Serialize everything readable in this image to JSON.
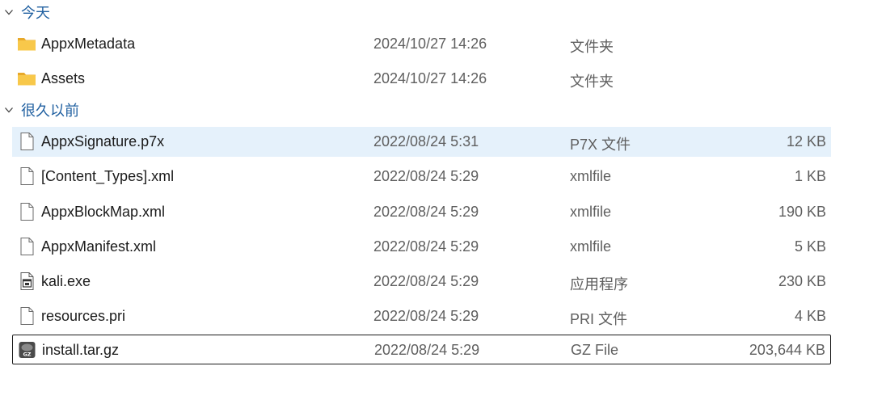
{
  "groups": [
    {
      "label": "今天",
      "items": [
        {
          "name": "AppxMetadata",
          "date": "2024/10/27 14:26",
          "type": "文件夹",
          "size": "",
          "icon": "folder-icon"
        },
        {
          "name": "Assets",
          "date": "2024/10/27 14:26",
          "type": "文件夹",
          "size": "",
          "icon": "folder-icon"
        }
      ]
    },
    {
      "label": "很久以前",
      "items": [
        {
          "name": "AppxSignature.p7x",
          "date": "2022/08/24 5:31",
          "type": "P7X 文件",
          "size": "12 KB",
          "icon": "file-icon"
        },
        {
          "name": "[Content_Types].xml",
          "date": "2022/08/24 5:29",
          "type": "xmlfile",
          "size": "1 KB",
          "icon": "file-icon"
        },
        {
          "name": "AppxBlockMap.xml",
          "date": "2022/08/24 5:29",
          "type": "xmlfile",
          "size": "190 KB",
          "icon": "file-icon"
        },
        {
          "name": "AppxManifest.xml",
          "date": "2022/08/24 5:29",
          "type": "xmlfile",
          "size": "5 KB",
          "icon": "file-icon"
        },
        {
          "name": "kali.exe",
          "date": "2022/08/24 5:29",
          "type": "应用程序",
          "size": "230 KB",
          "icon": "executable-icon"
        },
        {
          "name": "resources.pri",
          "date": "2022/08/24 5:29",
          "type": "PRI 文件",
          "size": "4 KB",
          "icon": "file-icon"
        },
        {
          "name": "install.tar.gz",
          "date": "2022/08/24 5:29",
          "type": "GZ File",
          "size": "203,644 KB",
          "icon": "gz-archive-icon",
          "archive_badge": "GZ"
        }
      ]
    }
  ],
  "colors": {
    "group_label": "#1f5fa0",
    "hover_row": "#e5f1fb",
    "folder": "#f8c84a"
  }
}
